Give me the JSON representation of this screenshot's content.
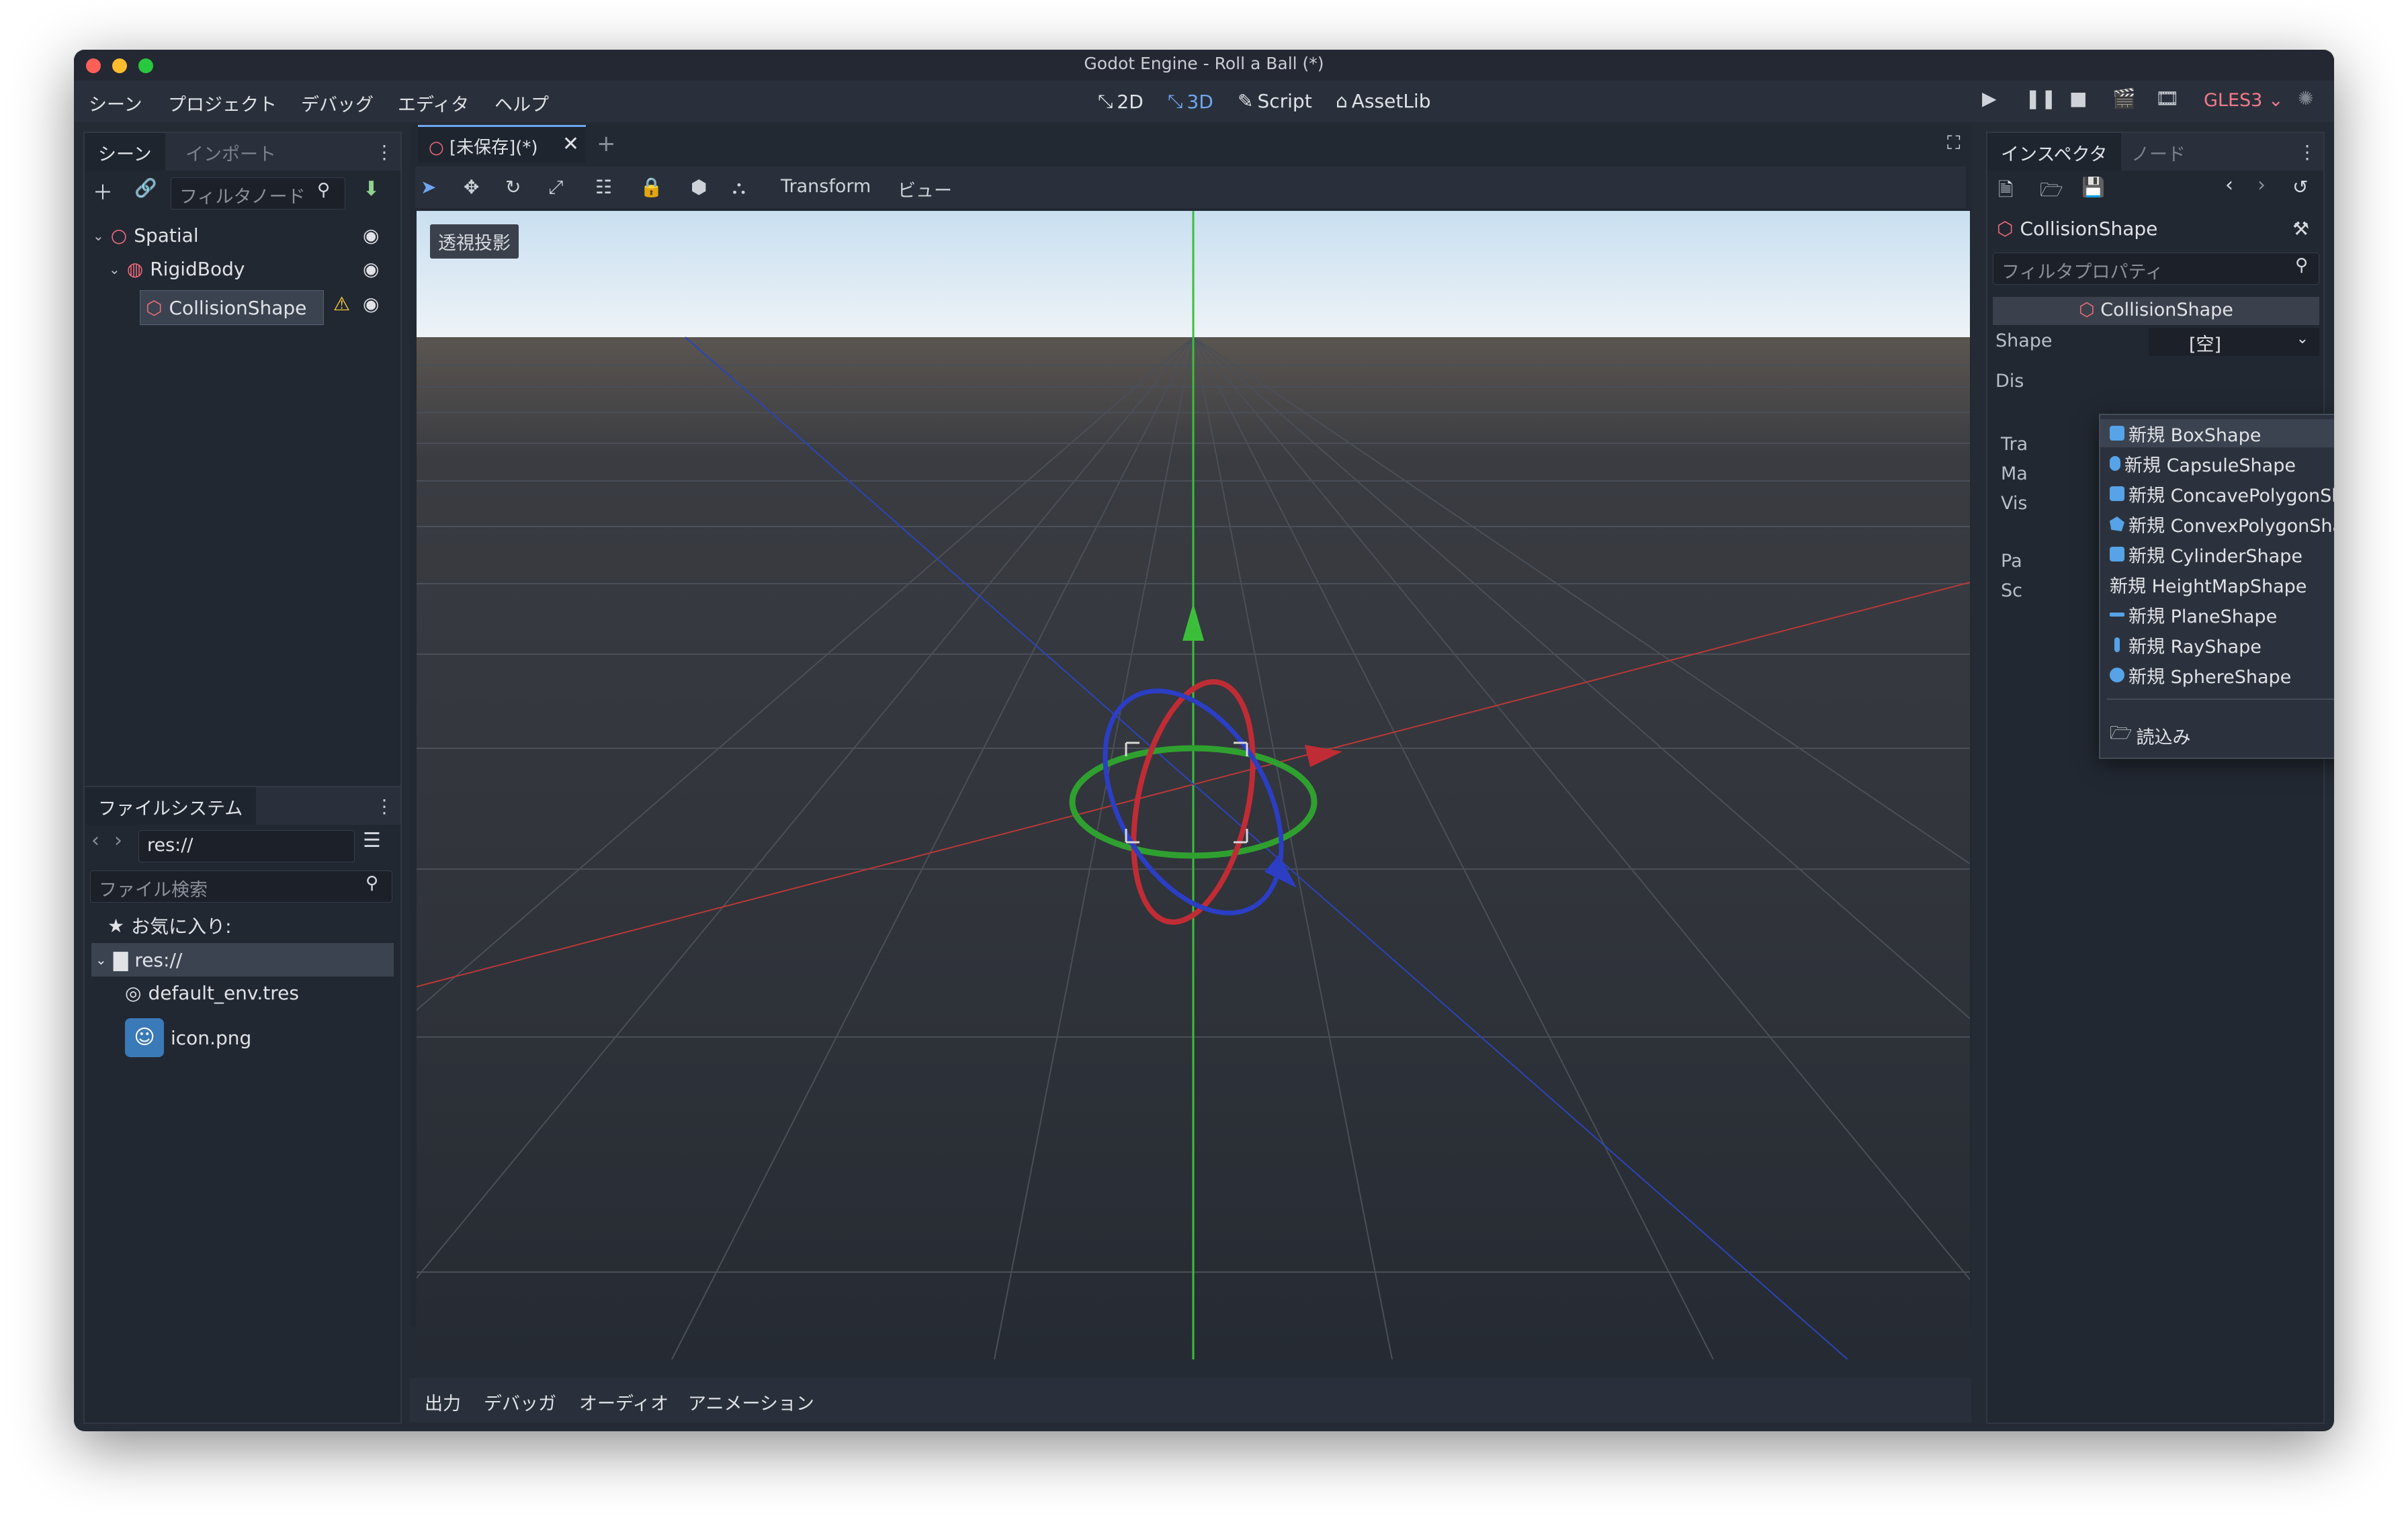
{
  "window": {
    "title": "Godot Engine - Roll a Ball (*)"
  },
  "menubar": {
    "menus": [
      "シーン",
      "プロジェクト",
      "デバッグ",
      "エディタ",
      "ヘルプ"
    ],
    "modes": {
      "m2d": "2D",
      "m3d": "3D",
      "script": "Script",
      "assetlib": "AssetLib"
    },
    "renderer": "GLES3"
  },
  "scene_panel": {
    "tabs": [
      "シーン",
      "インポート"
    ],
    "filter_placeholder": "フィルタノード",
    "nodes": [
      {
        "name": "Spatial"
      },
      {
        "name": "RigidBody"
      },
      {
        "name": "CollisionShape",
        "selected": true,
        "warning": true
      }
    ]
  },
  "filesystem_panel": {
    "tab": "ファイルシステム",
    "path": "res://",
    "search_placeholder": "ファイル検索",
    "favorites": "お気に入り:",
    "root": "res://",
    "files": [
      "default_env.tres",
      "icon.png"
    ]
  },
  "editor_tab": {
    "label": "[未保存](*)"
  },
  "viewport_toolbar": {
    "transform": "Transform",
    "view": "ビュー"
  },
  "viewport": {
    "projection_label": "透視投影"
  },
  "bottom_panel": {
    "tabs": [
      "出力",
      "デバッガ",
      "オーディオ",
      "アニメーション"
    ]
  },
  "inspector": {
    "tabs": [
      "インスペクタ",
      "ノード"
    ],
    "node_name": "CollisionShape",
    "filter_placeholder": "フィルタプロパティ",
    "section": "CollisionShape",
    "shape_label": "Shape",
    "shape_value": "[空]",
    "truncated_labels": [
      "Dis",
      "Tra",
      "Ma",
      "Vis",
      "Pa",
      "Sc"
    ]
  },
  "shape_dropdown": {
    "items": [
      {
        "label": "新規 BoxShape",
        "icon": "box-shape-icon"
      },
      {
        "label": "新規 CapsuleShape",
        "icon": "capsule-shape-icon"
      },
      {
        "label": "新規 ConcavePolygonShape",
        "icon": "concave-polygon-icon"
      },
      {
        "label": "新規 ConvexPolygonShape",
        "icon": "convex-polygon-icon"
      },
      {
        "label": "新規 CylinderShape",
        "icon": "cylinder-shape-icon"
      },
      {
        "label": "新規 HeightMapShape",
        "icon": ""
      },
      {
        "label": "新規 PlaneShape",
        "icon": "plane-shape-icon"
      },
      {
        "label": "新規 RayShape",
        "icon": "ray-shape-icon"
      },
      {
        "label": "新規 SphereShape",
        "icon": "sphere-shape-icon"
      }
    ],
    "load": "読込み"
  }
}
